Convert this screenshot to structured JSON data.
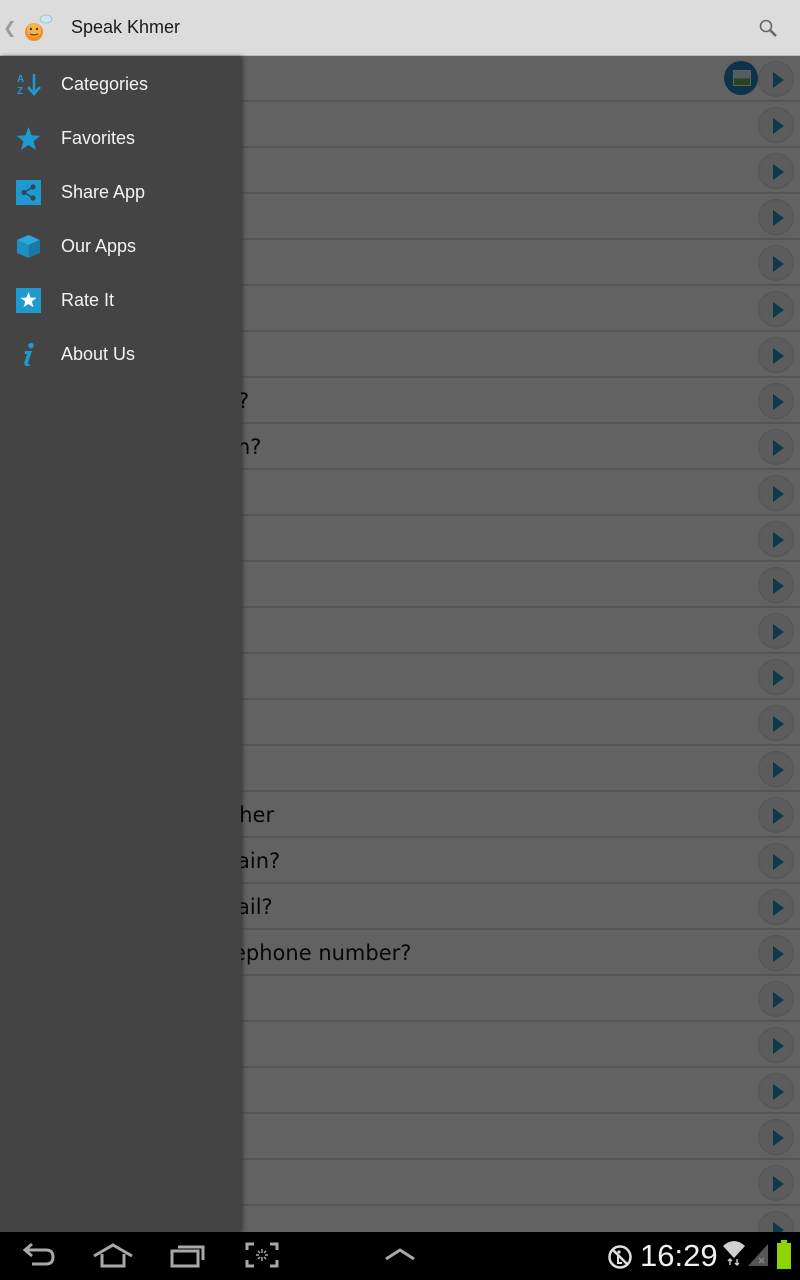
{
  "app": {
    "title": "Speak Khmer",
    "up_icon": "chevron-left-icon",
    "logo_icon": "smiley-speech-bubble-icon",
    "search_icon": "search-icon"
  },
  "drawer": {
    "items": [
      {
        "label": "Categories",
        "icon": "sort-az-icon"
      },
      {
        "label": "Favorites",
        "icon": "star-icon"
      },
      {
        "label": "Share App",
        "icon": "share-icon"
      },
      {
        "label": "Our Apps",
        "icon": "cube-icon"
      },
      {
        "label": "Rate It",
        "icon": "star-box-icon"
      },
      {
        "label": "About Us",
        "icon": "info-icon"
      }
    ]
  },
  "list": {
    "rows": [
      {
        "text": "",
        "has_image": true
      },
      {
        "text": ""
      },
      {
        "text": ""
      },
      {
        "text": ""
      },
      {
        "text": ""
      },
      {
        "text": ""
      },
      {
        "text": ""
      },
      {
        "text": "?"
      },
      {
        "text": "n?"
      },
      {
        "text": ""
      },
      {
        "text": ""
      },
      {
        "text": ""
      },
      {
        "text": ""
      },
      {
        "text": ""
      },
      {
        "text": ""
      },
      {
        "text": ""
      },
      {
        "text": "ther"
      },
      {
        "text": "ain?"
      },
      {
        "text": "ail?"
      },
      {
        "text": "ephone number?"
      },
      {
        "text": ""
      },
      {
        "text": ""
      },
      {
        "text": ""
      },
      {
        "text": ""
      },
      {
        "text": ""
      },
      {
        "text": ""
      }
    ]
  },
  "system_bar": {
    "time": "16:29",
    "battery_color": "#8fd400",
    "accent": "#1f9ad0"
  }
}
